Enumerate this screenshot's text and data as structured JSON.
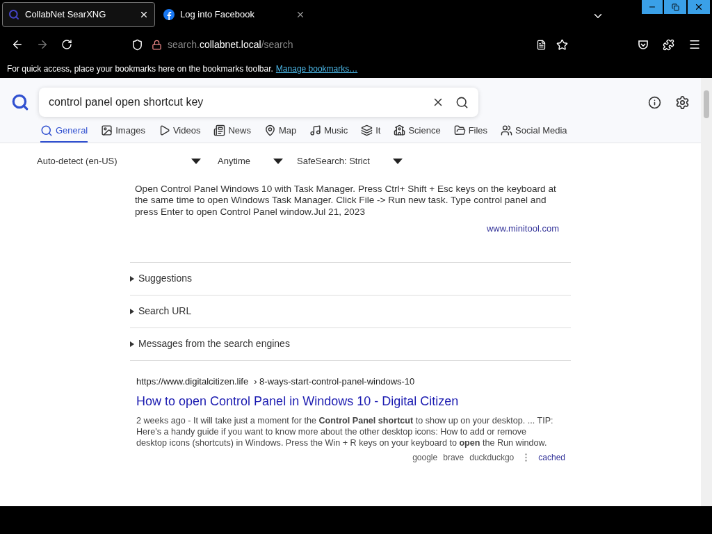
{
  "browser": {
    "tabs": [
      {
        "title": "CollabNet SearXNG",
        "selected": true,
        "kind": "search"
      },
      {
        "title": "Log into Facebook",
        "selected": false,
        "kind": "facebook"
      }
    ],
    "url": {
      "pre": "search.",
      "host": "collabnet.local",
      "post": "/search"
    },
    "bookmarks_bar": {
      "text": "For quick access, place your bookmarks here on the bookmarks toolbar.",
      "link": "Manage bookmarks…"
    }
  },
  "search": {
    "query": "control panel open shortcut key"
  },
  "categories": [
    {
      "label": "General",
      "selected": true,
      "kind": "search"
    },
    {
      "label": "Images",
      "selected": false,
      "kind": "image"
    },
    {
      "label": "Videos",
      "selected": false,
      "kind": "play"
    },
    {
      "label": "News",
      "selected": false,
      "kind": "news"
    },
    {
      "label": "Map",
      "selected": false,
      "kind": "map"
    },
    {
      "label": "Music",
      "selected": false,
      "kind": "music"
    },
    {
      "label": "It",
      "selected": false,
      "kind": "layers"
    },
    {
      "label": "Science",
      "selected": false,
      "kind": "science"
    },
    {
      "label": "Files",
      "selected": false,
      "kind": "files"
    },
    {
      "label": "Social Media",
      "selected": false,
      "kind": "social"
    }
  ],
  "filters": [
    {
      "label": "Auto-detect (en-US)"
    },
    {
      "label": "Anytime"
    },
    {
      "label": "SafeSearch: Strict"
    }
  ],
  "answer": {
    "text": "Open Control Panel Windows 10 with Task Manager. Press Ctrl+ Shift + Esc keys on the keyboard at the same time to open Windows Task Manager. Click File -> Run new task. Type control panel and press Enter to open Control Panel window.Jul 21, 2023",
    "source": "www.minitool.com"
  },
  "sections": [
    {
      "label": "Suggestions",
      "expanded": false
    },
    {
      "label": "Search URL",
      "expanded": false
    },
    {
      "label": "Messages from the search engines",
      "expanded": false
    }
  ],
  "results": [
    {
      "url": "https://www.digitalcitizen.life",
      "path": "› 8-ways-start-control-panel-windows-10",
      "title": "How to open Control Panel in Windows 10 - Digital Citizen",
      "snippet": "2 weeks ago - It will take just a moment for the **Control Panel shortcut** to show up on your desktop. ... TIP: Here's a handy guide if you want to know more about the other desktop icons: How to add or remove desktop icons (shortcuts) in Windows. Press the Win + R keys on your keyboard to **open** the Run window.",
      "engines": [
        "google",
        "brave",
        "duckduckgo"
      ],
      "cached": "cached"
    }
  ]
}
